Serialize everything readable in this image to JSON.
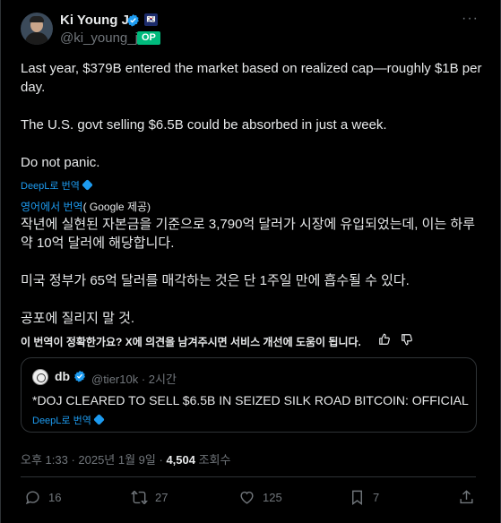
{
  "author": {
    "name": "Ki Young Ju",
    "handle": "@ki_young_ju",
    "op_badge": "OP",
    "flag_text": "🇰🇷"
  },
  "more_label": "···",
  "tweet": {
    "lines": [
      "Last year, $379B entered the market based on realized cap—roughly $1B per day.",
      "The U.S. govt selling $6.5B could be absorbed in just a week.",
      "Do not panic."
    ],
    "deepl_label": "DeepL로 번역"
  },
  "translation": {
    "from_prefix": "영어에서 번역",
    "from_suffix": "( Google 제공)",
    "lines": [
      "작년에 실현된 자본금을 기준으로 3,790억 달러가 시장에 유입되었는데, 이는 하루 약 10억 달러에 해당합니다.",
      "미국 정부가 65억 달러를 매각하는 것은 단 1주일 만에 흡수될 수 있다.",
      "공포에 질리지 말 것."
    ],
    "feedback": "이 번역이 정확한가요? X에 의견을 남겨주시면 서비스 개선에 도움이 됩니다."
  },
  "quote": {
    "name": "db",
    "handle": "@tier10k · 2시간",
    "text": "*DOJ CLEARED TO SELL $6.5B IN SEIZED SILK ROAD BITCOIN: OFFICIAL",
    "deepl_label": "DeepL로 번역"
  },
  "meta": {
    "time": "오후 1:33 · 2025년 1월 9일 · ",
    "views": "4,504",
    "views_label": " 조회수"
  },
  "actions": {
    "replies": "16",
    "reposts": "27",
    "likes": "125",
    "bookmarks": "7"
  },
  "colors": {
    "background": "#000000",
    "text": "#e7e9ea",
    "muted": "#71767b",
    "accent": "#1d9bf0",
    "op_green": "#00ba7c"
  }
}
